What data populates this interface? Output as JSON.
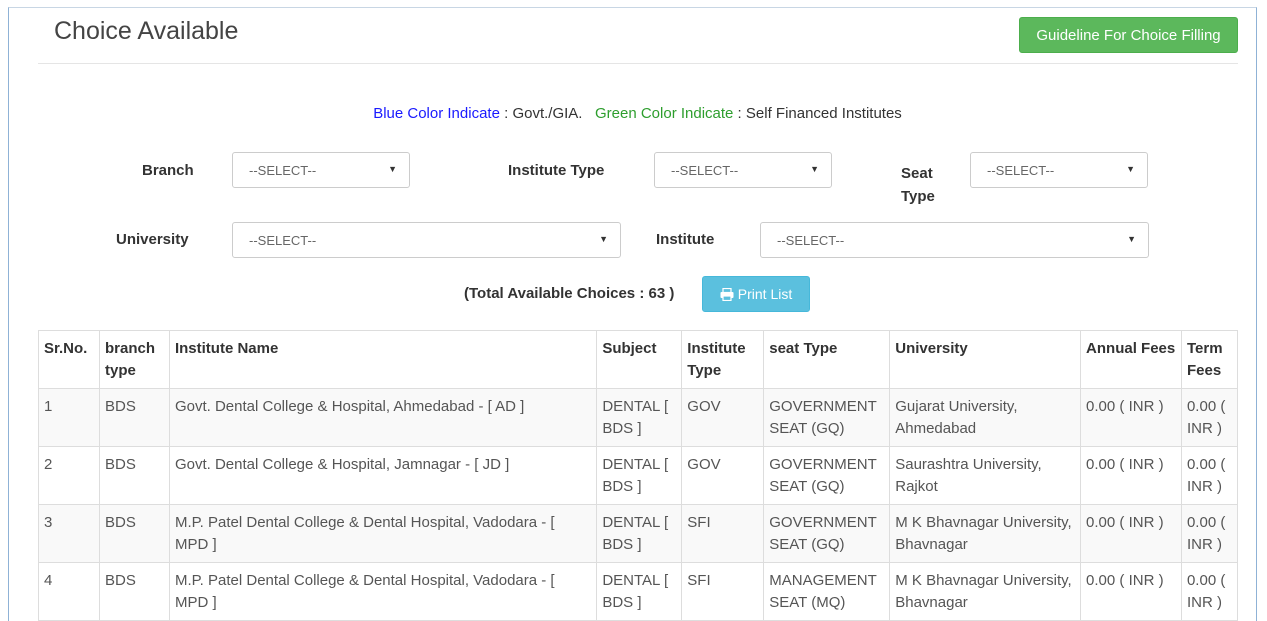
{
  "page": {
    "title": "Choice Available",
    "guideline_label": "Guideline For Choice Filling"
  },
  "legend": {
    "blue_label": "Blue Color Indicate",
    "blue_value": " : Govt./GIA.",
    "green_label": "Green Color Indicate",
    "green_value": " : Self Financed Institutes"
  },
  "filters": {
    "branch_label": "Branch",
    "branch_value": "--SELECT--",
    "institute_type_label": "Institute Type",
    "institute_type_value": "--SELECT--",
    "seat_type_label_1": "Seat",
    "seat_type_label_2": "Type",
    "seat_type_value": "--SELECT--",
    "university_label": "University",
    "university_value": "--SELECT--",
    "institute_label": "Institute",
    "institute_value": "--SELECT--"
  },
  "summary": {
    "total_text": "(Total Available Choices : 63 )",
    "print_label": "Print List"
  },
  "table": {
    "headers": [
      "Sr.No.",
      "branch type",
      "Institute Name",
      "Subject",
      "Institute Type",
      "seat Type",
      "University",
      "Annual Fees",
      "Term Fees"
    ],
    "rows": [
      [
        "1",
        "BDS",
        "Govt. Dental College & Hospital, Ahmedabad - [ AD ]",
        "DENTAL [ BDS ]",
        "GOV",
        "GOVERNMENT SEAT (GQ)",
        "Gujarat University, Ahmedabad",
        "0.00 ( INR )",
        "0.00 ( INR )"
      ],
      [
        "2",
        "BDS",
        "Govt. Dental College & Hospital, Jamnagar - [ JD ]",
        "DENTAL [ BDS ]",
        "GOV",
        "GOVERNMENT SEAT (GQ)",
        "Saurashtra University, Rajkot",
        "0.00 ( INR )",
        "0.00 ( INR )"
      ],
      [
        "3",
        "BDS",
        "M.P. Patel Dental College & Dental Hospital, Vadodara - [ MPD ]",
        "DENTAL [ BDS ]",
        "SFI",
        "GOVERNMENT SEAT (GQ)",
        "M K Bhavnagar University, Bhavnagar",
        "0.00 ( INR )",
        "0.00 ( INR )"
      ],
      [
        "4",
        "BDS",
        "M.P. Patel Dental College & Dental Hospital, Vadodara - [ MPD ]",
        "DENTAL [ BDS ]",
        "SFI",
        "MANAGEMENT SEAT (MQ)",
        "M K Bhavnagar University, Bhavnagar",
        "0.00 ( INR )",
        "0.00 ( INR )"
      ]
    ]
  },
  "icons": {
    "print": "print-icon",
    "dropdown": "chevron-down-icon"
  }
}
